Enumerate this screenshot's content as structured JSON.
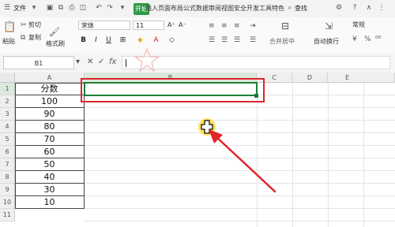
{
  "menubar": {
    "file_label": "文件",
    "start_tab": "开始",
    "menu_strip": "插入页面布局公式数据审阅视图安全开发工具特色",
    "search_label": "查找"
  },
  "ribbon": {
    "paste": "粘贴",
    "cut": "剪切",
    "copy": "复制",
    "format_painter": "格式刷",
    "font_name": "宋体",
    "font_size": "11",
    "merge_center": "合并居中",
    "auto_wrap": "自动换行",
    "number_format": "常规",
    "format_glyphs": [
      "B",
      "I",
      "U",
      "⊞",
      "◈",
      "A",
      "◇"
    ],
    "size_up": "A⁺",
    "size_down": "A⁻"
  },
  "formula_bar": {
    "name_box": "B1",
    "cancel": "✕",
    "confirm": "✓",
    "fx": "fx",
    "value": ""
  },
  "sheet": {
    "columns": [
      "A",
      "B",
      "C",
      "D",
      "E"
    ],
    "rows": [
      "1",
      "2",
      "3",
      "4",
      "5",
      "6",
      "7",
      "8",
      "9",
      "10",
      "11"
    ],
    "col_a": [
      "分数",
      "100",
      "90",
      "80",
      "70",
      "60",
      "50",
      "40",
      "30",
      "10"
    ]
  },
  "colors": {
    "accent_green": "#2e9b47",
    "annotation_red": "#e0242a",
    "selection_green": "#1e7e34"
  }
}
